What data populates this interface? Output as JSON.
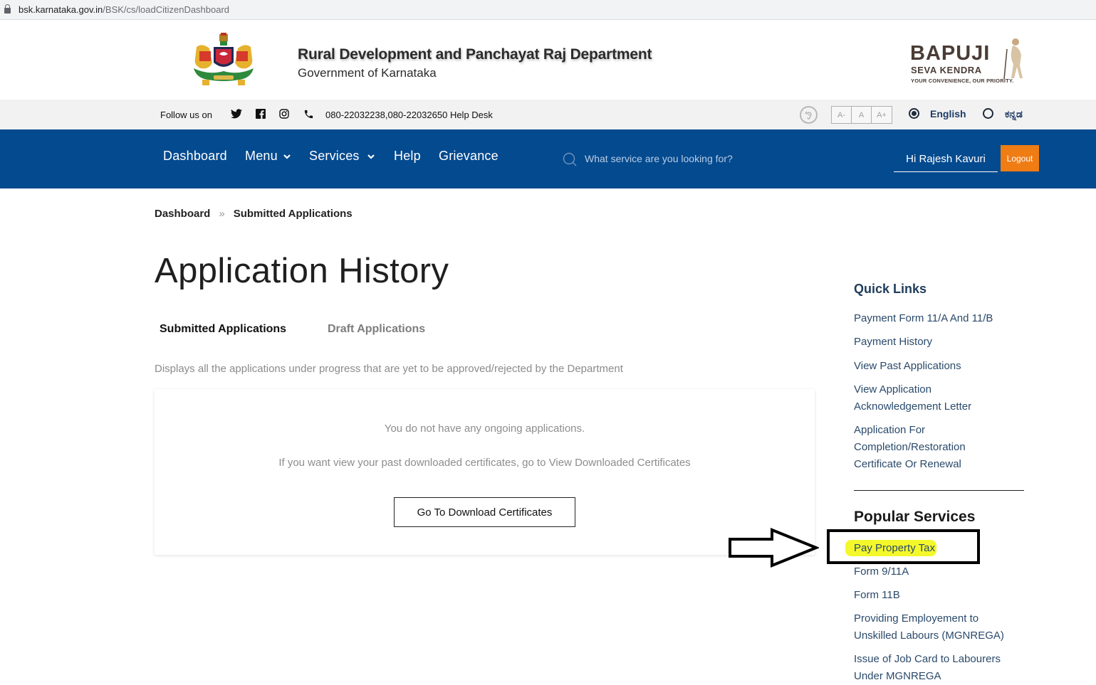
{
  "browser": {
    "url_host": "bsk.karnataka.gov.in",
    "url_path": "/BSK/cs/loadCitizenDashboard"
  },
  "header": {
    "title": "Rural Development and Panchayat Raj Department",
    "subtitle": "Government of Karnataka",
    "logo": {
      "line1": "BAPUJI",
      "line2": "SEVA KENDRA",
      "tagline": "YOUR CONVENIENCE, OUR PRIORITY."
    }
  },
  "utility_bar": {
    "follow_label": "Follow us on",
    "social_icons": [
      "twitter-icon",
      "facebook-icon",
      "instagram-icon",
      "phone-icon"
    ],
    "helpdesk": "080-22032238,080-22032650 Help Desk",
    "font_size_buttons": [
      "A-",
      "A",
      "A+"
    ],
    "languages": [
      {
        "label": "English",
        "selected": true
      },
      {
        "label": "ಕನ್ನಡ",
        "selected": false
      }
    ]
  },
  "nav": {
    "items": [
      {
        "label": "Dashboard",
        "dropdown": false
      },
      {
        "label": "Menu",
        "dropdown": true
      },
      {
        "label": "Services",
        "dropdown": true
      },
      {
        "label": "Help",
        "dropdown": false
      },
      {
        "label": "Grievance",
        "dropdown": false
      }
    ],
    "search_placeholder": "What service are you looking for?",
    "search_value": "",
    "greeting": "Hi Rajesh Kavuri",
    "logout_label": "Logout"
  },
  "breadcrumb": {
    "items": [
      "Dashboard",
      "Submitted Applications"
    ],
    "separator": "»"
  },
  "main": {
    "page_title": "Application History",
    "tabs": [
      {
        "label": "Submitted Applications",
        "active": true
      },
      {
        "label": "Draft Applications",
        "active": false
      }
    ],
    "description": "Displays all the applications under progress that are yet to be approved/rejected by the Department",
    "empty_message": "You do not have any ongoing applications.",
    "certificates_hint": "If you want view your past downloaded certificates, go to View Downloaded Certificates",
    "download_button": "Go To Download Certificates"
  },
  "sidebar": {
    "quick_links_title": "Quick Links",
    "quick_links": [
      "Payment Form 11/A And 11/B",
      "Payment History",
      "View Past Applications",
      "View Application Acknowledgement Letter",
      "Application For Completion/Restoration Certificate Or Renewal"
    ],
    "popular_services_title": "Popular Services",
    "popular_services": [
      "Pay Property Tax",
      "Form 9/11A",
      "Form 11B",
      "Providing Employement to Unskilled Labours (MGNREGA)",
      "Issue of Job Card to Labourers Under MGNREGA"
    ]
  },
  "annotation": {
    "highlighted_item": "Pay Property Tax",
    "highlight_color": "#f4f82a"
  },
  "colors": {
    "nav_bg": "#044a8f",
    "logout_bg": "#f07c14",
    "utility_bg": "#f2f2f2",
    "link_color": "#2a4a6b"
  }
}
